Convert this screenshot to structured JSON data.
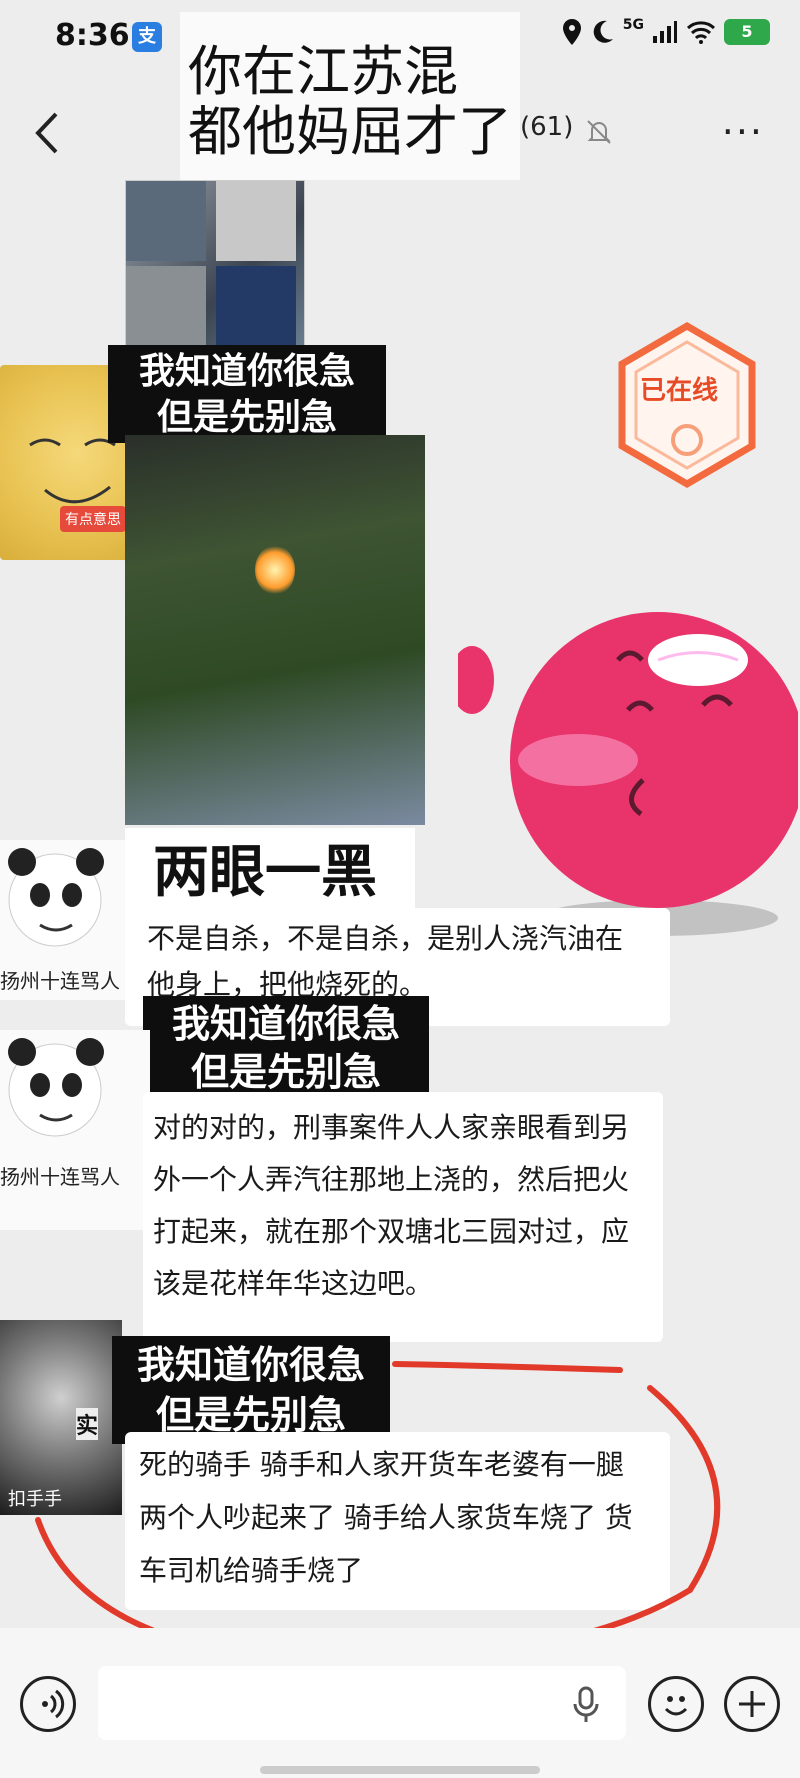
{
  "status_bar": {
    "time": "8:36",
    "app_icon_glyph": "支",
    "network": "5G",
    "icons": [
      "location-icon",
      "moon-icon",
      "signal-icon",
      "wifi-icon",
      "battery-icon"
    ],
    "battery": "5"
  },
  "header": {
    "title_line1": "你在江苏混",
    "title_line2": "都他妈屈才了",
    "member_count": "(61)"
  },
  "avatars": {
    "yellow_badge": "有点意思",
    "panda_caption": "扬州十连骂人",
    "blur_char": "实",
    "blur_caption": "扣手手"
  },
  "online_badge": {
    "label": "已在线"
  },
  "messages": {
    "meme_line1": "我知道你很急",
    "meme_line2": "但是先别急",
    "big_label": "两眼一黑",
    "msg1": "不是自杀，不是自杀，是别人浇汽油在他身上，把他烧死的。",
    "msg2": "对的对的，刑事案件人人家亲眼看到另外一个人弄汽往那地上浇的，然后把火打起来，就在那个双塘北三园对过，应该是花样年华这边吧。",
    "msg3": "死的骑手  骑手和人家开货车老婆有一腿  两个人吵起来了  骑手给人家货车烧了  货车司机给骑手烧了"
  },
  "input_bar": {
    "placeholder": ""
  },
  "colors": {
    "background": "#ededed",
    "accent_red": "#e23a2a",
    "online_orange": "#f26a3d",
    "pink_ball": "#e8336b"
  }
}
